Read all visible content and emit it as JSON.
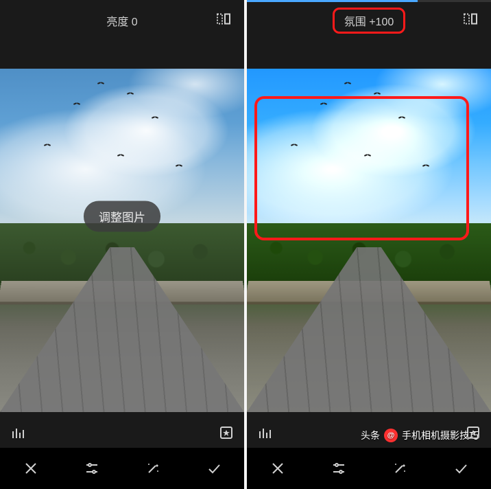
{
  "left": {
    "param_label": "亮度 0",
    "toast_label": "调整图片"
  },
  "right": {
    "param_label": "氛围 +100"
  },
  "watermark": {
    "prefix": "头条",
    "at": "@",
    "account": "手机相机摄影技巧"
  },
  "icons": {
    "compare": "compare-icon",
    "histogram": "histogram-icon",
    "star": "star-icon",
    "close": "close-icon",
    "sliders": "sliders-icon",
    "magic": "magic-wand-icon",
    "check": "checkmark-icon"
  },
  "annotations": {
    "highlight_param": true,
    "red_box": {
      "top_pct": 8,
      "left_pct": 2,
      "width_pct": 88,
      "height_pct": 42
    }
  }
}
